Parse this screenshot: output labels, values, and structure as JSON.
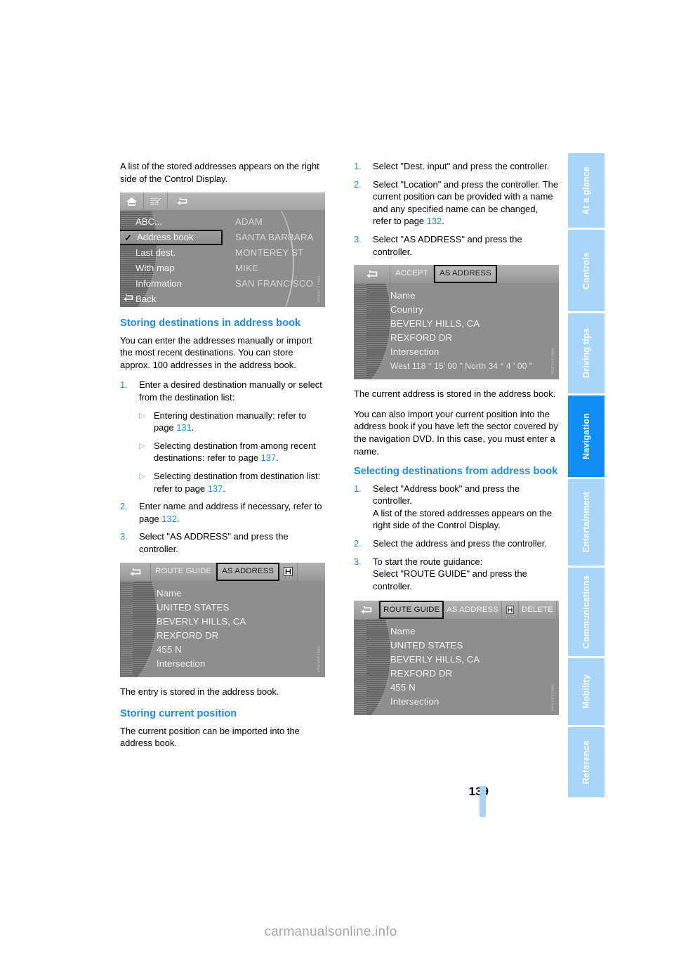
{
  "document": {
    "page_number": "139",
    "watermark": "carmanualsonline.info"
  },
  "side_tabs": [
    {
      "label": "At a glance",
      "active": false
    },
    {
      "label": "Controls",
      "active": false
    },
    {
      "label": "Driving tips",
      "active": false
    },
    {
      "label": "Navigation",
      "active": true
    },
    {
      "label": "Entertainment",
      "active": false
    },
    {
      "label": "Communications",
      "active": false
    },
    {
      "label": "Mobility",
      "active": false
    },
    {
      "label": "Reference",
      "active": false
    }
  ],
  "left_column": {
    "intro": "A list of the stored addresses appears on the right side of the Control Display.",
    "menu_screenshot": {
      "code": "MNT17XX5A",
      "icons": [
        "home-icon",
        "map-pencil-icon"
      ],
      "left_items": [
        {
          "label": "ABC...",
          "selected": false,
          "checked": false
        },
        {
          "label": "Address book",
          "selected": true,
          "checked": true
        },
        {
          "label": "Last dest.",
          "selected": false,
          "checked": false
        },
        {
          "label": "With map",
          "selected": false,
          "checked": false
        },
        {
          "label": "Information",
          "selected": false,
          "checked": false
        },
        {
          "label": "Back",
          "selected": false,
          "checked": false,
          "icon": "back-arrow-icon"
        }
      ],
      "right_items": [
        "ADAM",
        "SANTA BARBARA",
        "MONTEREY ST",
        "MIKE",
        "SAN FRANCISCO"
      ],
      "back_icon": "back-arrow-icon"
    },
    "heading_storing": "Storing destinations in address book",
    "storing_body": "You can enter the addresses manually or import the most recent destinations. You can store approx. 100 addresses in the address book.",
    "storing_steps": [
      {
        "num": "1.",
        "text": "Enter a desired destination manually or select from the destination list:",
        "subs": [
          {
            "pre": "Entering destination manually: refer to page ",
            "ref": "131",
            "post": "."
          },
          {
            "pre": "Selecting destination from among recent destinations: refer to page ",
            "ref": "137",
            "post": "."
          },
          {
            "pre": "Selecting destination from destination list: refer to page ",
            "ref": "137",
            "post": "."
          }
        ]
      },
      {
        "num": "2.",
        "pre": "Enter name and address if necessary, refer to page ",
        "ref": "132",
        "post": "."
      },
      {
        "num": "3.",
        "text": "Select \"AS ADDRESS\" and press the controller."
      }
    ],
    "address_screenshot": {
      "code": "MNT15XX5A",
      "toolbar": [
        {
          "label": "back-arrow-icon",
          "type": "icon"
        },
        {
          "label": "ROUTE GUIDE",
          "type": "text"
        },
        {
          "label": "AS ADDRESS",
          "type": "selected"
        },
        {
          "label": "info-icon",
          "type": "icon-dark"
        }
      ],
      "lines": [
        "Name",
        "UNITED STATES",
        "BEVERLY HILLS, CA",
        "REXFORD DR",
        "455 N",
        "Intersection"
      ]
    },
    "entry_stored": "The entry is stored in the address book.",
    "heading_current_position": "Storing current position",
    "current_position_body": "The current position can be imported into the address book."
  },
  "right_column": {
    "steps_top": [
      {
        "num": "1.",
        "text": "Select \"Dest. input\" and press the controller."
      },
      {
        "num": "2.",
        "pre": "Select \"Location\" and press the controller. The current position can be provided with a name and any specified name can be changed, refer to page ",
        "ref": "132",
        "post": "."
      },
      {
        "num": "3.",
        "text": "Select \"AS ADDRESS\" and press the controller."
      }
    ],
    "accept_screenshot": {
      "code": "MNT16XX5A",
      "toolbar": [
        {
          "label": "back-arrow-icon",
          "type": "icon"
        },
        {
          "label": "ACCEPT",
          "type": "text"
        },
        {
          "label": "AS ADDRESS",
          "type": "selected"
        }
      ],
      "lines": [
        "Name",
        "Country",
        "BEVERLY HILLS, CA",
        "REXFORD DR",
        "Intersection"
      ],
      "coords": "West 118 ° 15' 00 \"    North 34 ° 4 ' 00 \""
    },
    "stored_note": "The current address is stored in the address book.",
    "import_note": "You can also import your current position into the address book if you have left the sector covered by the navigation DVD. In this case, you must enter a name.",
    "heading_selecting": "Selecting destinations from address book",
    "selecting_steps": [
      {
        "num": "1.",
        "text": "Select \"Address book\" and press the controller.\nA list of the stored addresses appears on the right side of the Control Display."
      },
      {
        "num": "2.",
        "text": "Select the address and press the controller."
      },
      {
        "num": "3.",
        "text": "To start the route guidance:\nSelect \"ROUTE GUIDE\" and press the controller."
      }
    ],
    "route_screenshot": {
      "code": "MNT18XX5A",
      "toolbar": [
        {
          "label": "back-arrow-icon",
          "type": "icon"
        },
        {
          "label": "ROUTE GUIDE",
          "type": "selected"
        },
        {
          "label": "AS ADDRESS",
          "type": "text"
        },
        {
          "label": "info-icon",
          "type": "icon-dark"
        },
        {
          "label": "DELETE",
          "type": "text"
        }
      ],
      "lines": [
        "Name",
        "UNITED STATES",
        "BEVERLY HILLS, CA",
        "REXFORD DR",
        "455 N",
        "Intersection"
      ]
    }
  }
}
